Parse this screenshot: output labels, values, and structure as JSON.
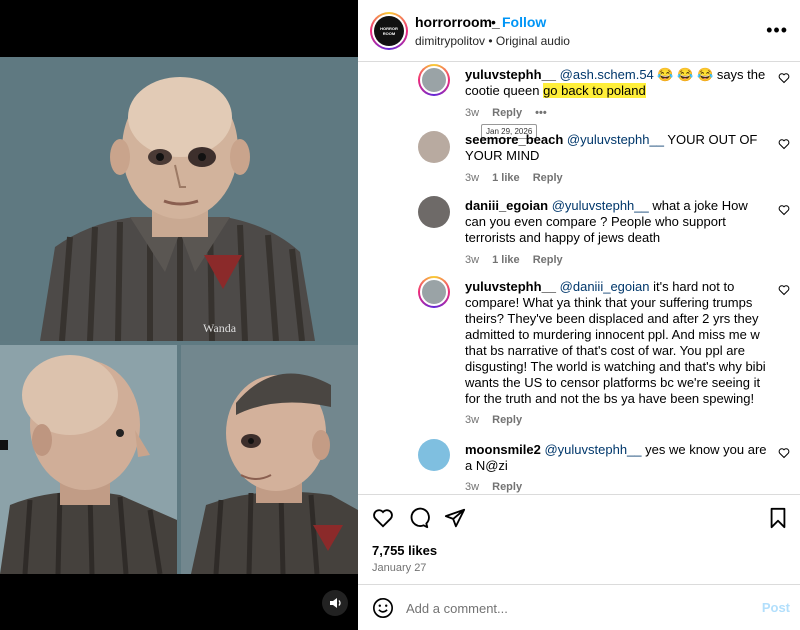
{
  "post": {
    "account": "horrorroom_",
    "avatar_text": "HORROR ROOM",
    "follow_label": "Follow",
    "separator": "•",
    "audio_user": "dimitrypolitov",
    "audio_label": "Original audio",
    "more_label": "•••"
  },
  "comments": [
    {
      "user": "yuluvstephh__",
      "mention": "@ash.schem.54",
      "emojis": "😂 😂 😂",
      "text_a": " says the cootie queen ",
      "highlight": "go back to poland",
      "time": "3w",
      "reply": "Reply",
      "options": "•••",
      "tooltip": "Jan 29, 2026"
    },
    {
      "user": "seemore_beach",
      "mention": "@yuluvstephh__",
      "text": " YOUR OUT OF YOUR MIND",
      "time": "3w",
      "likes": "1 like",
      "reply": "Reply"
    },
    {
      "user": "daniii_egoian",
      "mention": "@yuluvstephh__",
      "text": " what a joke How can you even compare ? People who support terrorists and happy of jews death",
      "time": "3w",
      "likes": "1 like",
      "reply": "Reply"
    },
    {
      "user": "yuluvstephh__",
      "mention": "@daniii_egoian",
      "text": " it's hard not to compare! What ya think that your suffering trumps theirs? They've been displaced and after 2 yrs they admitted to murdering innocent ppl. And miss me w that bs narrative of that's cost of war. You ppl are disgusting! The world is watching and that's why bibi wants the US to censor platforms bc we're seeing it for the truth and not the bs ya have been spewing!",
      "time": "3w",
      "reply": "Reply"
    },
    {
      "user": "moonsmile2",
      "mention": "@yuluvstephh__",
      "text": " yes we know you are a N@zi",
      "time": "3w",
      "reply": "Reply"
    }
  ],
  "stats": {
    "likes": "7,755 likes",
    "date": "January 27"
  },
  "composer": {
    "placeholder": "Add a comment...",
    "post_label": "Post"
  },
  "colors": {
    "follow": "#0095f6",
    "mention": "#00376b",
    "highlight": "#ffef3a",
    "post_disabled": "#b2dffc"
  }
}
